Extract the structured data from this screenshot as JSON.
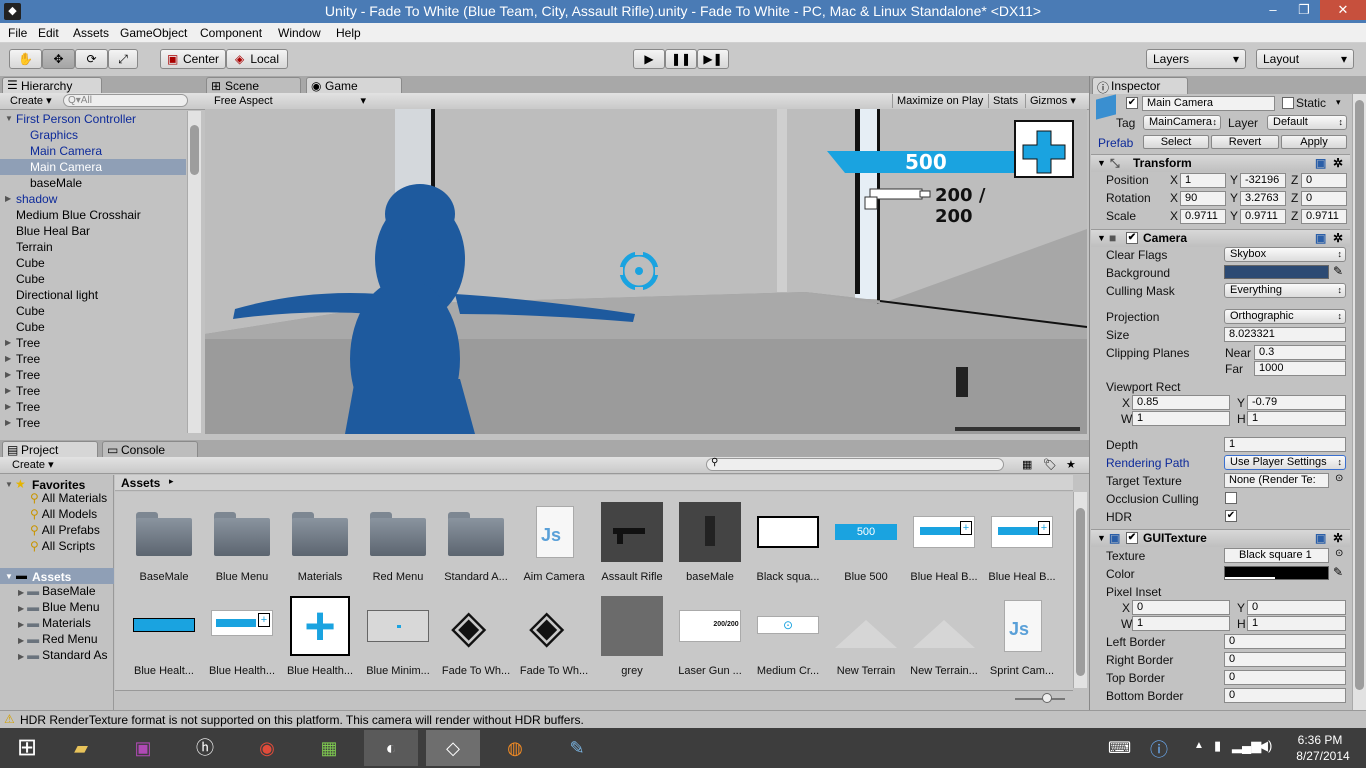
{
  "window": {
    "title": "Unity - Fade To White (Blue Team, City, Assault Rifle).unity - Fade To White - PC, Mac & Linux Standalone* <DX11>",
    "min": "–",
    "max": "❐",
    "close": "✕"
  },
  "menu": [
    "File",
    "Edit",
    "Assets",
    "GameObject",
    "Component",
    "Window",
    "Help"
  ],
  "toolbar": {
    "pivot": "Center",
    "space": "Local",
    "layers": "Layers",
    "layout": "Layout"
  },
  "hierarchy": {
    "tab": "Hierarchy",
    "create": "Create",
    "search_placeholder": "Q▾All",
    "items": [
      {
        "label": "First Person Controller",
        "indent": 0,
        "arrow": "▼",
        "color": "blue"
      },
      {
        "label": "Graphics",
        "indent": 1,
        "arrow": "",
        "color": "blue"
      },
      {
        "label": "Main Camera",
        "indent": 1,
        "arrow": "",
        "color": "blue"
      },
      {
        "label": "Main Camera",
        "indent": 1,
        "arrow": "",
        "color": "sel"
      },
      {
        "label": "baseMale",
        "indent": 1,
        "arrow": "",
        "color": "black"
      },
      {
        "label": "shadow",
        "indent": 0,
        "arrow": "▶",
        "color": "blue"
      },
      {
        "label": "Medium Blue Crosshair",
        "indent": 0,
        "arrow": "",
        "color": "black"
      },
      {
        "label": "Blue Heal Bar",
        "indent": 0,
        "arrow": "",
        "color": "black"
      },
      {
        "label": "Terrain",
        "indent": 0,
        "arrow": "",
        "color": "black"
      },
      {
        "label": "Cube",
        "indent": 0,
        "arrow": "",
        "color": "black"
      },
      {
        "label": "Cube",
        "indent": 0,
        "arrow": "",
        "color": "black"
      },
      {
        "label": "Directional light",
        "indent": 0,
        "arrow": "",
        "color": "black"
      },
      {
        "label": "Cube",
        "indent": 0,
        "arrow": "",
        "color": "black"
      },
      {
        "label": "Cube",
        "indent": 0,
        "arrow": "",
        "color": "black"
      },
      {
        "label": "Tree",
        "indent": 0,
        "arrow": "▶",
        "color": "black"
      },
      {
        "label": "Tree",
        "indent": 0,
        "arrow": "▶",
        "color": "black"
      },
      {
        "label": "Tree",
        "indent": 0,
        "arrow": "▶",
        "color": "black"
      },
      {
        "label": "Tree",
        "indent": 0,
        "arrow": "▶",
        "color": "black"
      },
      {
        "label": "Tree",
        "indent": 0,
        "arrow": "▶",
        "color": "black"
      },
      {
        "label": "Tree",
        "indent": 0,
        "arrow": "▶",
        "color": "black"
      }
    ]
  },
  "scene_tab": "Scene",
  "game": {
    "tab": "Game",
    "aspect": "Free Aspect",
    "maximize": "Maximize on Play",
    "stats": "Stats",
    "gizmos": "Gizmos",
    "hud_score": "500",
    "hud_ammo": "200 / 200"
  },
  "project": {
    "tab": "Project",
    "console_tab": "Console",
    "create": "Create",
    "breadcrumb": "Assets",
    "favorites_label": "Favorites",
    "favorites": [
      "All Materials",
      "All Models",
      "All Prefabs",
      "All Scripts"
    ],
    "assets_label": "Assets",
    "folders": [
      "BaseMale",
      "Blue Menu",
      "Materials",
      "Red Menu",
      "Standard As"
    ],
    "assets_row1": [
      "BaseMale",
      "Blue Menu",
      "Materials",
      "Red Menu",
      "Standard A...",
      "Aim Camera",
      "Assault Rifle",
      "baseMale",
      "Black squa...",
      "Blue 500",
      "Blue Heal B...",
      "Blue Heal B..."
    ],
    "assets_row2": [
      "Blue Healt...",
      "Blue Health...",
      "Blue Health...",
      "Blue Minim...",
      "Fade To Wh...",
      "Fade To Wh...",
      "grey",
      "Laser Gun ...",
      "Medium Cr...",
      "New Terrain",
      "New Terrain...",
      "Sprint Cam..."
    ]
  },
  "inspector": {
    "tab": "Inspector",
    "name": "Main Camera",
    "static": "Static",
    "tag_label": "Tag",
    "tag": "MainCamera",
    "layer_label": "Layer",
    "layer": "Default",
    "prefab_label": "Prefab",
    "select": "Select",
    "revert": "Revert",
    "apply": "Apply",
    "transform": {
      "title": "Transform",
      "position_label": "Position",
      "position": [
        "1",
        "-32196",
        "0"
      ],
      "rotation_label": "Rotation",
      "rotation": [
        "90",
        "3.2763",
        "0"
      ],
      "scale_label": "Scale",
      "scale": [
        "0.9711",
        "0.9711",
        "0.9711"
      ]
    },
    "camera": {
      "title": "Camera",
      "clear_flags_label": "Clear Flags",
      "clear_flags": "Skybox",
      "background_label": "Background",
      "culling_mask_label": "Culling Mask",
      "culling_mask": "Everything",
      "projection_label": "Projection",
      "projection": "Orthographic",
      "size_label": "Size",
      "size": "8.023321",
      "clipping_label": "Clipping Planes",
      "near_label": "Near",
      "near": "0.3",
      "far_label": "Far",
      "far": "1000",
      "viewport_label": "Viewport Rect",
      "vx": "0.85",
      "vy": "-0.79",
      "vw": "1",
      "vh": "1",
      "depth_label": "Depth",
      "depth": "1",
      "rendering_path_label": "Rendering Path",
      "rendering_path": "Use Player Settings",
      "target_texture_label": "Target Texture",
      "target_texture": "None (Render Te:",
      "occlusion_label": "Occlusion Culling",
      "hdr_label": "HDR"
    },
    "guitexture": {
      "title": "GUITexture",
      "texture_label": "Texture",
      "texture": "Black square 1",
      "color_label": "Color",
      "pixel_inset_label": "Pixel Inset",
      "px": "0",
      "py": "0",
      "pw": "1",
      "ph": "1",
      "left_border_label": "Left Border",
      "left_border": "0",
      "right_border_label": "Right Border",
      "right_border": "0",
      "top_border_label": "Top Border",
      "top_border": "0",
      "bottom_border_label": "Bottom Border",
      "bottom_border": "0"
    }
  },
  "status": "HDR RenderTexture format is not supported on this platform. This camera will render without HDR buffers.",
  "taskbar": {
    "time": "6:36 PM",
    "date": "8/27/2014"
  },
  "colors": {
    "accent": "#0d2a9a",
    "hud_blue": "#1aa3e0",
    "character_blue": "#1e5a9e",
    "camera_bg": "#2c4a73"
  }
}
